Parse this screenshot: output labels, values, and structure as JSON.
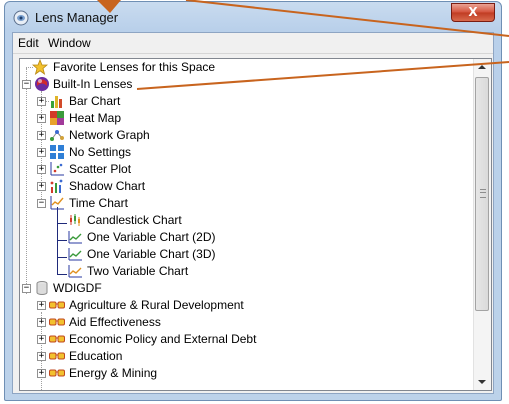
{
  "window": {
    "title": "Lens Manager",
    "close_glyph": "X"
  },
  "menu": [
    "Edit",
    "Window"
  ],
  "tree": {
    "favorites": "Favorite Lenses for this Space",
    "builtin": "Built-In Lenses",
    "builtin_items": [
      "Bar Chart",
      "Heat Map",
      "Network Graph",
      "No Settings",
      "Scatter Plot",
      "Shadow Chart",
      "Time Chart"
    ],
    "time_chart_children": [
      "Candlestick Chart",
      "One Variable Chart (2D)",
      "One Variable Chart (3D)",
      "Two Variable Chart"
    ],
    "dataset": "WDIGDF",
    "dataset_items": [
      "Agriculture & Rural Development",
      "Aid Effectiveness",
      "Economic Policy and External Debt",
      "Education",
      "Energy & Mining"
    ]
  },
  "colors": {
    "callout": "#c8641e",
    "title_gradient": "#c9dbef",
    "close": "#c03b22"
  }
}
